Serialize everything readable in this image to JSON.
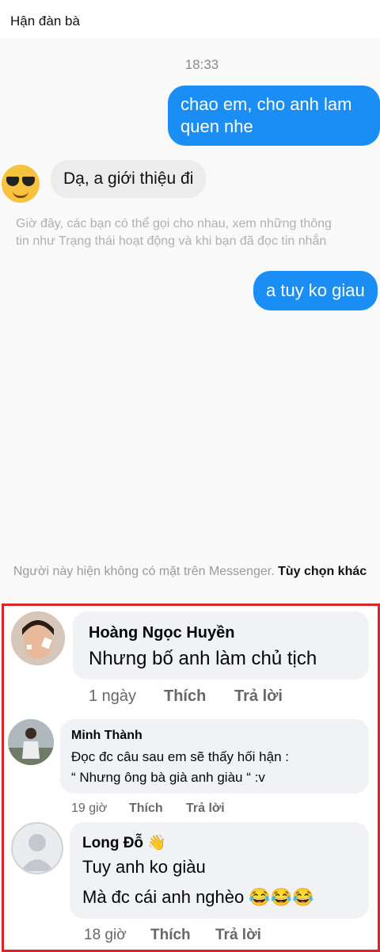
{
  "header": {
    "title": "Hận đàn bà"
  },
  "chat": {
    "time": "18:33",
    "out1": "chao em, cho anh lam quen nhe",
    "in1": "Dạ, a giới thiệu đi",
    "system_line1": "Giờ đây, các bạn có thể gọi cho nhau, xem những thông",
    "system_line2": "tin như Trạng thái hoạt động và khi bạn đã đọc tin nhắn",
    "out2": "a tuy ko giau",
    "messenger_notice": "Người này hiện không có mặt trên Messenger.",
    "messenger_more": "Tùy chọn khác"
  },
  "comments": [
    {
      "name": "Hoàng Ngọc Huyền",
      "text": "Nhưng bố anh làm chủ tịch",
      "time": "1 ngày",
      "like": "Thích",
      "reply": "Trả lời"
    },
    {
      "name": "Minh Thành",
      "text1": "Đọc đc câu sau em sẽ thấy hối hận :",
      "text2": "“ Nhưng ông bà già anh giàu “ :v",
      "time": "19 giờ",
      "like": "Thích",
      "reply": "Trả lời"
    },
    {
      "name": "Long Đỗ",
      "name_icon": "👋",
      "text1": "Tuy anh ko giàu",
      "text2": "Mà đc cái anh nghèo",
      "emojis": "😂😂😂",
      "time": "18 giờ",
      "like": "Thích",
      "reply": "Trả lời"
    }
  ],
  "colors": {
    "messenger_blue": "#1a8ef5",
    "highlight_red": "#d9252b",
    "comment_bg": "#f0f2f5"
  }
}
